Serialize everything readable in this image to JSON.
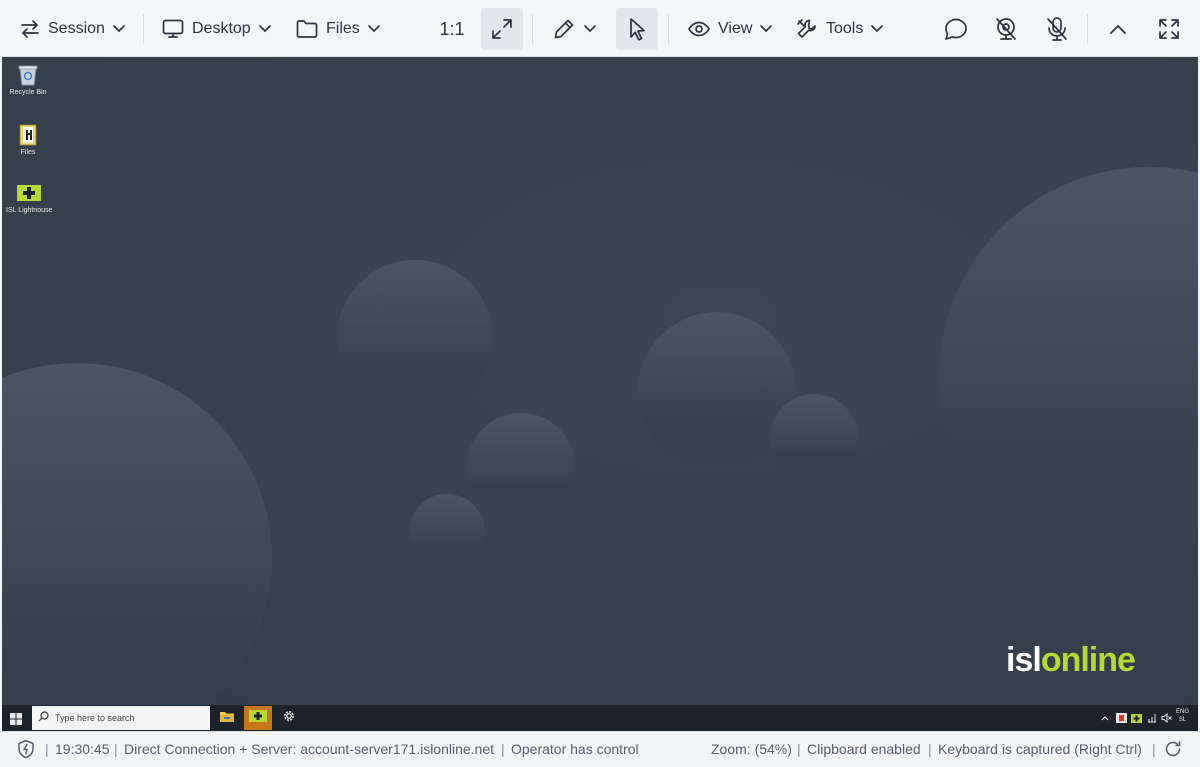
{
  "toolbar": {
    "session_label": "Session",
    "desktop_label": "Desktop",
    "files_label": "Files",
    "scale_label": "1:1",
    "view_label": "View",
    "tools_label": "Tools"
  },
  "desktop": {
    "icons": [
      {
        "label": "Recycle Bin",
        "icon": "recycle-bin-icon"
      },
      {
        "label": "Files",
        "icon": "files-shortcut-icon"
      },
      {
        "label": "ISL Lightnouse",
        "icon": "isl-light-icon"
      }
    ],
    "brand_white": "isl",
    "brand_green": "online"
  },
  "taskbar": {
    "search_placeholder": "Type here to search",
    "lang_line1": "ENG",
    "lang_line2": "SL"
  },
  "status": {
    "time": "19:30:45",
    "connection": "Direct Connection + Server: account-server171.islonline.net",
    "control": "Operator has control",
    "zoom": "Zoom: (54%)",
    "clipboard": "Clipboard enabled",
    "keyboard": "Keyboard is captured (Right Ctrl)"
  },
  "colors": {
    "brand_green": "#b6d936",
    "desktop_bg": "#37414e",
    "taskbar_active": "#c8761b"
  }
}
